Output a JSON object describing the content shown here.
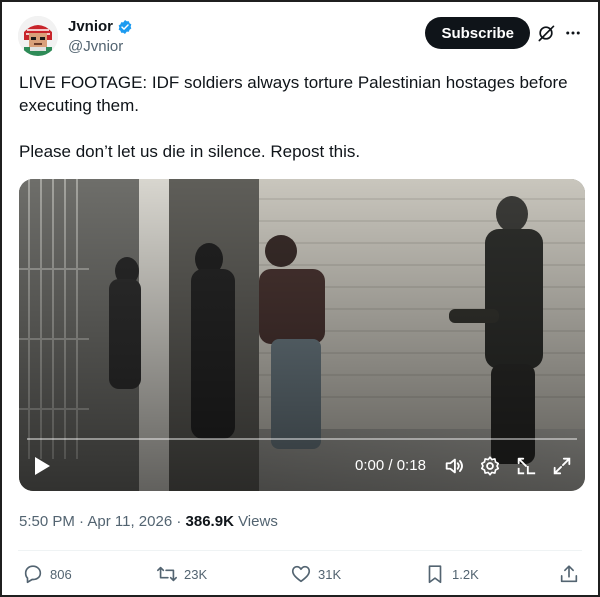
{
  "author": {
    "display_name": "Jvnior",
    "handle": "@Jvnior",
    "verified": true
  },
  "header": {
    "subscribe_label": "Subscribe",
    "icons": [
      "grok-icon",
      "more-icon"
    ]
  },
  "tweet": {
    "text": "LIVE FOOTAGE: IDF soldiers always torture Palestinian hostages before executing them.\n\nPlease don’t let us die in silence. Repost this."
  },
  "video": {
    "progress": 0,
    "current_time": "0:00",
    "separator": " / ",
    "duration": "0:18",
    "controls": [
      "play-icon",
      "volume-icon",
      "settings-icon",
      "pip-icon",
      "fullscreen-icon"
    ]
  },
  "meta": {
    "time": "5:50 PM",
    "sep1": " · ",
    "date": "Apr 11, 2026",
    "sep2": " · ",
    "views_count": "386.9K",
    "views_label": " Views"
  },
  "actions": {
    "replies": "806",
    "reposts": "23K",
    "likes": "31K",
    "bookmarks": "1.2K"
  },
  "colors": {
    "accent_blue": "#1d9bf0",
    "text_primary": "#0f1419",
    "text_secondary": "#536471",
    "button_dark": "#0f1419"
  }
}
